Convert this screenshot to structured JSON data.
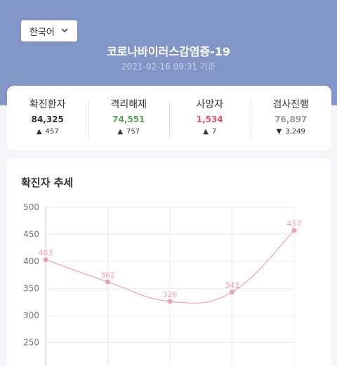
{
  "header": {
    "language": "한국어",
    "title": "코로나바이러스감염증-19",
    "updated": "2021-02-16 09:31 기준"
  },
  "stats": [
    {
      "label": "확진환자",
      "value": "84,325",
      "direction": "up",
      "change": "457",
      "color": "#333333"
    },
    {
      "label": "격리해제",
      "value": "74,551",
      "direction": "up",
      "change": "757",
      "color": "#5aa55a"
    },
    {
      "label": "사망자",
      "value": "1,534",
      "direction": "up",
      "change": "7",
      "color": "#e0555f"
    },
    {
      "label": "검사진행",
      "value": "76,897",
      "direction": "down",
      "change": "3,249",
      "color": "#999999"
    }
  ],
  "trend": {
    "title": "확진자 추세"
  },
  "colors": {
    "hero": "#8195c7",
    "line": "#f29fb0"
  },
  "chart_data": {
    "type": "line",
    "title": "확진자 추세",
    "xlabel": "",
    "ylabel": "",
    "x": [
      1,
      2,
      3,
      4,
      5
    ],
    "yticks": [
      250,
      300,
      350,
      400,
      450,
      500
    ],
    "ylim": [
      200,
      500
    ],
    "grid": true,
    "series": [
      {
        "values": [
          403,
          362,
          326,
          343,
          457
        ]
      }
    ]
  }
}
